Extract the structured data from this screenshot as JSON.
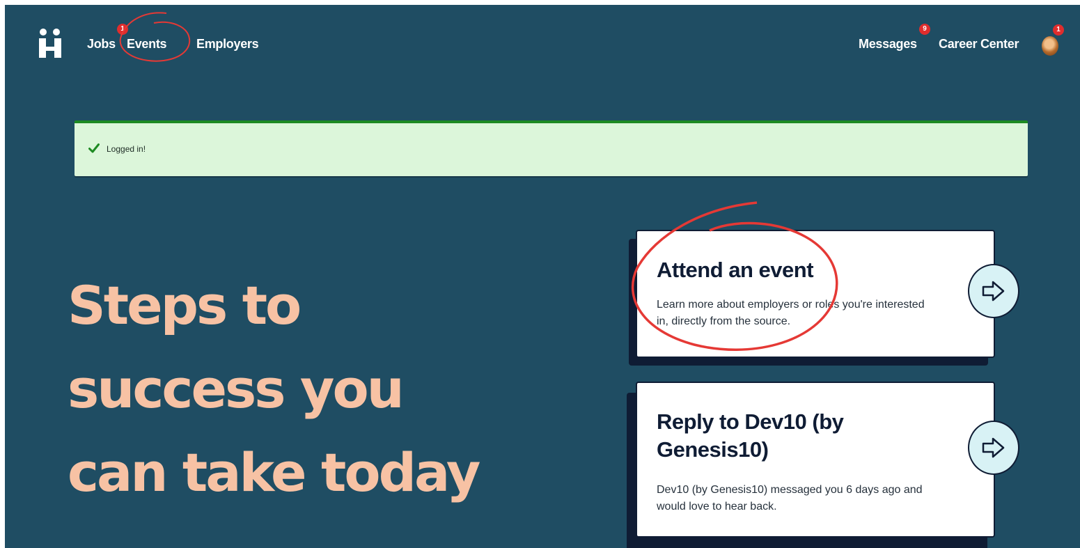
{
  "nav": {
    "left": [
      {
        "label": "Jobs",
        "badge": "1"
      },
      {
        "label": "Events"
      },
      {
        "label": "Employers"
      }
    ],
    "right": [
      {
        "label": "Messages",
        "badge": "9"
      },
      {
        "label": "Career Center"
      }
    ],
    "avatar_badge": "1"
  },
  "alert": {
    "text": "Logged in!",
    "icon": "check-icon",
    "color": "#1d8a22"
  },
  "hero": {
    "lines": [
      "Steps to",
      "success you",
      "can take today"
    ]
  },
  "cards": [
    {
      "title": "Attend an event",
      "description": "Learn more about employers or roles you're interested in, directly from the source.",
      "icon": "arrow-right-icon"
    },
    {
      "title": "Reply to Dev10 (by Genesis10)",
      "description": "Dev10 (by Genesis10) messaged you 6 days ago and would love to hear back.",
      "icon": "arrow-right-icon"
    }
  ],
  "colors": {
    "background": "#1f4d63",
    "hero_text": "#f7c2a4",
    "badge": "#e02d2d",
    "annotation": "#e53935",
    "alert_bg": "#dcf6da",
    "arrow_bg": "#d8f2f5"
  }
}
